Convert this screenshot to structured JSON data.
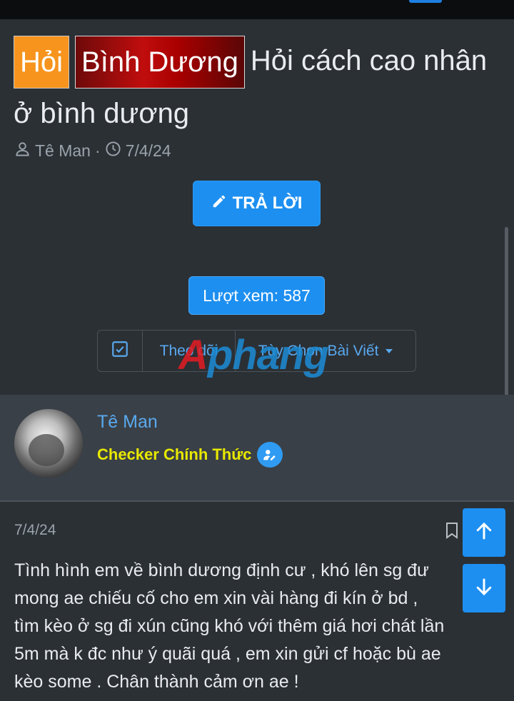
{
  "thread": {
    "prefix_1": "Hỏi",
    "prefix_2": "Bình Dương",
    "title": "Hỏi cách cao nhân ở bình dương",
    "author": "Tê Man",
    "separator": "·",
    "date": "7/4/24"
  },
  "actions": {
    "reply_label": "TRẢ LỜI",
    "views_label": "Lượt xem: 587",
    "follow_label": "Theo dõi",
    "options_label": "Tùy Chọn Bài Viết"
  },
  "watermark": {
    "part_1": "A",
    "part_2": "phang"
  },
  "post": {
    "author_name": "Tê Man",
    "author_title": "Checker Chính Thức",
    "date": "7/4/24",
    "body_lines": [
      "Tình hình em về bình dương định cư , khó lên sg đư",
      "mong ae chiếu cố cho em xin vài hàng đi kín ở bd ,",
      "tìm kèo ở sg đi xún cũng khó với thêm giá hơi chát lần",
      "5m mà k đc như ý quãi quá , em xin gửi cf hoặc bù ae",
      "kèo some . Chân thành cảm ơn ae !"
    ]
  },
  "icons": {
    "author": "user-icon",
    "date": "clock-icon",
    "reply": "pencil-icon",
    "follow": "checkbox-icon",
    "badge": "verified-user-icon",
    "bookmark": "bookmark-icon",
    "up": "arrow-up-icon",
    "down": "arrow-down-icon"
  },
  "colors": {
    "background": "#2b3035",
    "accent": "#1d8ff0",
    "prefix_hoi": "#f7941d",
    "prefix_bd": "#c00d0d",
    "author_title": "#e8e800",
    "link": "#5aa9ee"
  }
}
